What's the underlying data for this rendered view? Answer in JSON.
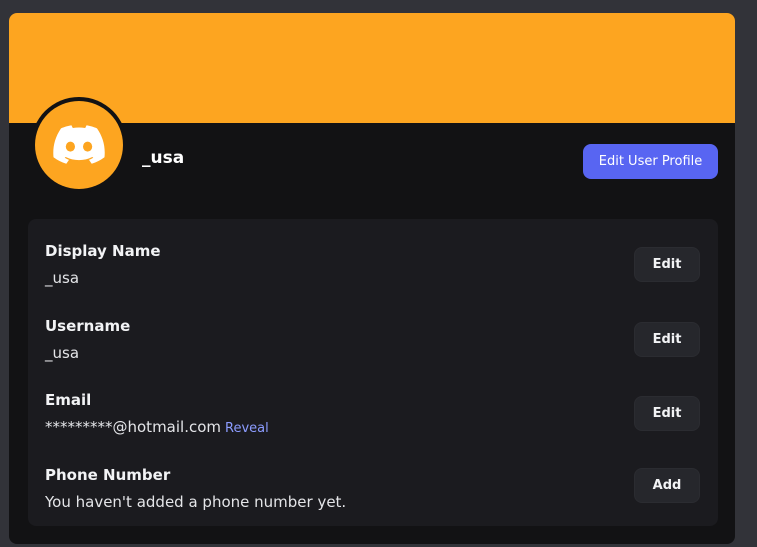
{
  "colors": {
    "banner": "#fda520",
    "avatar_bg": "#fda520",
    "accent_button": "#5865f2",
    "reveal_link": "#8c9cff"
  },
  "profile": {
    "username": "_usa",
    "edit_profile_label": "Edit User Profile",
    "avatar_icon": "discord-logo-icon"
  },
  "fields": [
    {
      "label": "Display Name",
      "value": "_usa",
      "action": "Edit"
    },
    {
      "label": "Username",
      "value": "_usa",
      "action": "Edit"
    },
    {
      "label": "Email",
      "value": "*********@hotmail.com",
      "reveal": "Reveal",
      "action": "Edit"
    },
    {
      "label": "Phone Number",
      "value": "You haven't added a phone number yet.",
      "action": "Add"
    }
  ]
}
